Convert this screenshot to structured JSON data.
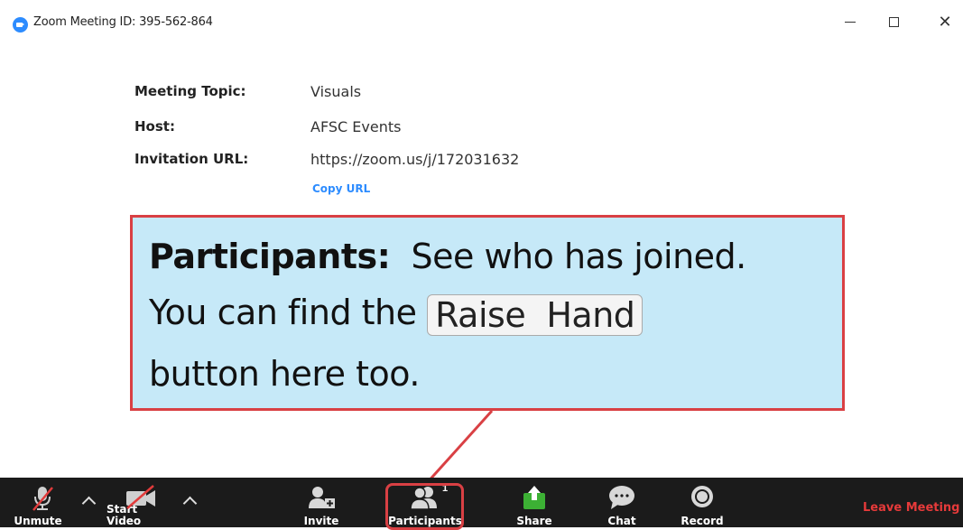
{
  "window": {
    "title": "Zoom Meeting ID: 395-562-864",
    "controls": [
      "minimize",
      "maximize",
      "close"
    ],
    "close_glyph": "✕"
  },
  "info": {
    "topic_label": "Meeting Topic:",
    "topic_value": "Visuals",
    "host_label": "Host:",
    "host_value": "AFSC Events",
    "url_label": "Invitation URL:",
    "url_value": "https://zoom.us/j/172031632",
    "copy_url": "Copy URL"
  },
  "callout": {
    "heading": "Participants:",
    "line1_rest": "See who has joined.",
    "line2_pre": "You can find the",
    "raise_hand": "Raise  Hand",
    "line3": "button here too.",
    "border_color": "#d94044",
    "fill_color": "#c6e9f8"
  },
  "toolbar": {
    "unmute": "Unmute",
    "start_video": "Start Video",
    "invite": "Invite",
    "participants": "Participants",
    "participants_count": "1",
    "share": "Share",
    "chat": "Chat",
    "record": "Record",
    "leave": "Leave Meeting",
    "share_color": "#3cb034",
    "leave_color": "#e63a3a"
  }
}
